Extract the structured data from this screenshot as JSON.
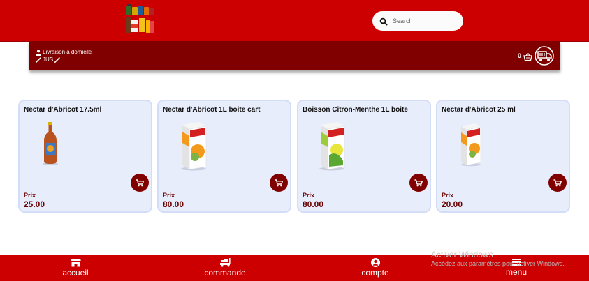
{
  "header": {
    "search": {
      "placeholder": "Search"
    }
  },
  "info_band": {
    "delivery_label": "Livraison à domicile",
    "category_label": "JUS",
    "cart_count": "0"
  },
  "products": [
    {
      "name": "Nectar d'Abricot 17.5ml",
      "price_label": "Prix",
      "price": "25.00"
    },
    {
      "name": "Nectar d'Abricot 1L boite cart",
      "price_label": "Prix",
      "price": "80.00"
    },
    {
      "name": "Boisson Citron-Menthe 1L boite",
      "price_label": "Prix",
      "price": "80.00"
    },
    {
      "name": "Nectar d'Abricot 25 ml",
      "price_label": "Prix",
      "price": "20.00"
    }
  ],
  "nav": {
    "items": [
      {
        "label": "accueil",
        "icon": "store-icon"
      },
      {
        "label": "commande",
        "icon": "delivery-icon"
      },
      {
        "label": "compte",
        "icon": "account-icon"
      },
      {
        "label": "menu",
        "icon": "menu-icon"
      }
    ]
  },
  "watermark": {
    "title": "Activer Windows",
    "subtitle": "Accédez aux paramètres pour activer Windows."
  },
  "colors": {
    "brand_red": "#cc0000",
    "dark_red": "#800000",
    "card_bg": "#e8edfb",
    "price_color": "#6a0000"
  }
}
